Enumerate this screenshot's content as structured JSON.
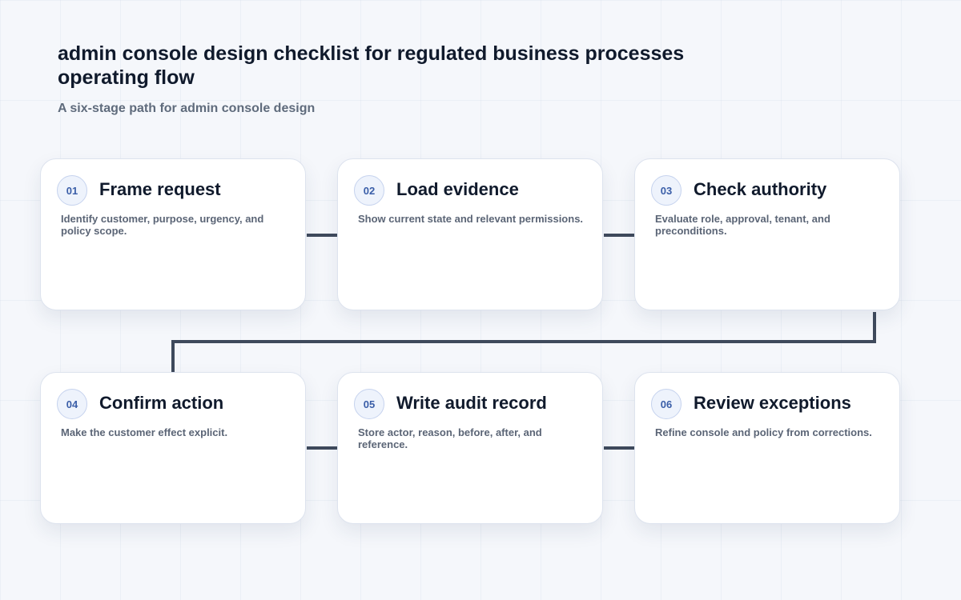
{
  "header": {
    "title": "admin console design checklist for regulated business processes operating flow",
    "subtitle": "A six-stage path for admin console design"
  },
  "steps": [
    {
      "number": "01",
      "title": "Frame request",
      "description": "Identify customer, purpose, urgency, and policy scope."
    },
    {
      "number": "02",
      "title": "Load evidence",
      "description": "Show current state and relevant permissions."
    },
    {
      "number": "03",
      "title": "Check authority",
      "description": "Evaluate role, approval, tenant, and preconditions."
    },
    {
      "number": "04",
      "title": "Confirm action",
      "description": "Make the customer effect explicit."
    },
    {
      "number": "05",
      "title": "Write audit record",
      "description": "Store actor, reason, before, after, and reference."
    },
    {
      "number": "06",
      "title": "Review exceptions",
      "description": "Refine console and policy from corrections."
    }
  ],
  "colors": {
    "connector": "#3f4a5c",
    "badge_text": "#3a5ea8",
    "title_text": "#101a2c",
    "muted_text": "#5b6576"
  }
}
